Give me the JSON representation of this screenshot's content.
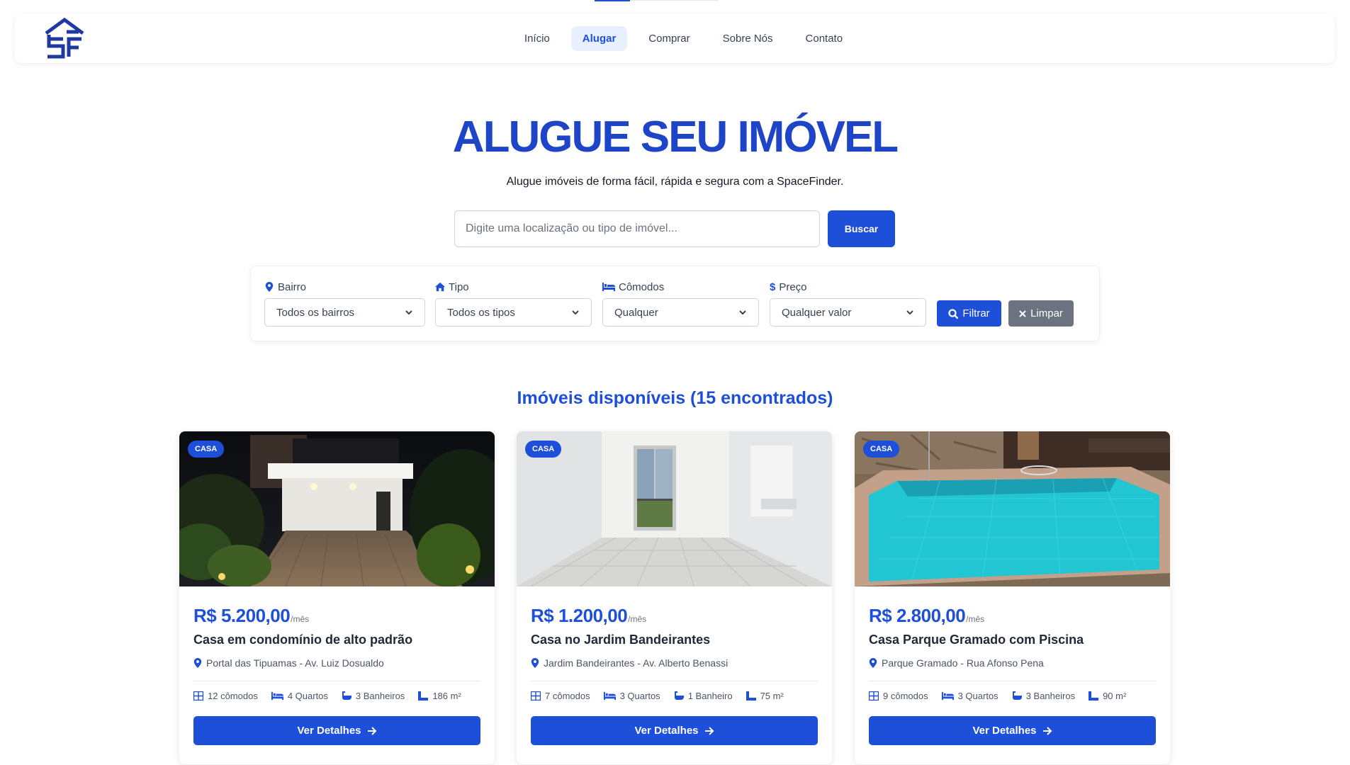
{
  "brand": {
    "logo_name": "spacefinder-logo",
    "accent": "#1e4fd8"
  },
  "nav": {
    "items": [
      {
        "label": "Início",
        "active": false
      },
      {
        "label": "Alugar",
        "active": true
      },
      {
        "label": "Comprar",
        "active": false
      },
      {
        "label": "Sobre Nós",
        "active": false
      },
      {
        "label": "Contato",
        "active": false
      }
    ]
  },
  "hero": {
    "title": "ALUGUE SEU IMÓVEL",
    "subtitle": "Alugue imóveis de forma fácil, rápida e segura com a SpaceFinder."
  },
  "search": {
    "placeholder": "Digite uma localização ou tipo de imóvel...",
    "button_label": "Buscar"
  },
  "filters": {
    "bairro": {
      "label": "Bairro",
      "value": "Todos os bairros",
      "icon": "map-pin-icon"
    },
    "tipo": {
      "label": "Tipo",
      "value": "Todos os tipos",
      "icon": "home-icon"
    },
    "comodos": {
      "label": "Cômodos",
      "value": "Qualquer",
      "icon": "bed-icon"
    },
    "preco": {
      "label": "Preço",
      "value": "Qualquer valor",
      "icon": "dollar-icon"
    },
    "filter_button": "Filtrar",
    "clear_button": "Limpar"
  },
  "results": {
    "title": "Imóveis disponíveis (15 encontrados)"
  },
  "listings": [
    {
      "badge": "CASA",
      "price": "R$ 5.200,00",
      "per": "/mês",
      "title": "Casa em condomínio de alto padrão",
      "address": "Portal das Tipuamas - Av. Luiz Dosualdo",
      "rooms": "12 cômodos",
      "bedrooms": "4 Quartos",
      "bathrooms": "3 Banheiros",
      "area": "186 m²",
      "button": "Ver Detalhes"
    },
    {
      "badge": "CASA",
      "price": "R$ 1.200,00",
      "per": "/mês",
      "title": "Casa no Jardim Bandeirantes",
      "address": "Jardim Bandeirantes - Av. Alberto Benassi",
      "rooms": "7 cômodos",
      "bedrooms": "3 Quartos",
      "bathrooms": "1 Banheiro",
      "area": "75 m²",
      "button": "Ver Detalhes"
    },
    {
      "badge": "CASA",
      "price": "R$ 2.800,00",
      "per": "/mês",
      "title": "Casa Parque Gramado com Piscina",
      "address": "Parque Gramado - Rua Afonso Pena",
      "rooms": "9 cômodos",
      "bedrooms": "3 Quartos",
      "bathrooms": "3 Banheiros",
      "area": "90 m²",
      "button": "Ver Detalhes"
    }
  ]
}
